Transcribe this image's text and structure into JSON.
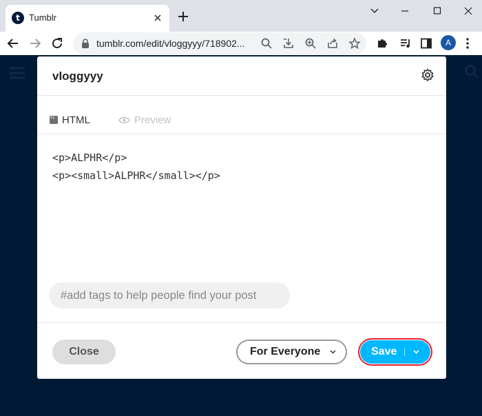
{
  "browser": {
    "tab_title": "Tumblr",
    "favicon_letter": "t",
    "url": "tumblr.com/edit/vloggyyy/718902...",
    "profile_initial": "A"
  },
  "modal": {
    "blog_name": "vloggyyy",
    "tabs": {
      "html": "HTML",
      "preview": "Preview"
    },
    "editor_lines": [
      "<p>ALPHR</p>",
      "<p><small>ALPHR</small></p>"
    ],
    "tags_placeholder": "#add tags to help people find your post",
    "buttons": {
      "close": "Close",
      "audience": "For Everyone",
      "save": "Save"
    }
  },
  "colors": {
    "page_background": "#001935",
    "save_button": "#00b8ff",
    "save_highlight_border": "#e22033"
  }
}
